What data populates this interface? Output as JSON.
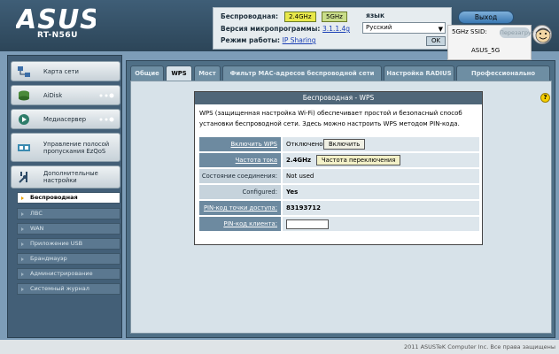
{
  "brand": {
    "logo": "ASUS",
    "model": "RT-N56U"
  },
  "sysinfo": {
    "wireless_label": "Беспроводная:",
    "freq_a": "2.4GHz",
    "freq_b": "5GHz",
    "firmware_label": "Версия микропрограммы:",
    "firmware_value": "3.1.1.4g",
    "mode_label": "Режим работы:",
    "mode_value": "IP Sharing"
  },
  "language": {
    "label": "язык",
    "selected": "Русский",
    "ok": "OK"
  },
  "logout": "Выход",
  "ssid": {
    "label": "5GHz SSID:",
    "value": "ASUS_5G",
    "ghost_button": "Перезагрузка"
  },
  "sidebar": {
    "items": [
      {
        "label": "Карта сети",
        "icon": "network-map-icon"
      },
      {
        "label": "AiDisk",
        "icon": "aidisk-icon"
      },
      {
        "label": "Медиасервер",
        "icon": "media-server-icon"
      },
      {
        "label": "Управление полосой пропускания EzQoS",
        "icon": "ezqos-icon"
      },
      {
        "label": "Дополнительные настройки",
        "icon": "advanced-settings-icon"
      }
    ],
    "sub_items": [
      "Беспроводная",
      "ЛВС",
      "WAN",
      "Приложение USB",
      "Брандмауэр",
      "Администрирование",
      "Системный журнал"
    ]
  },
  "tabs": [
    "Общие",
    "WPS",
    "Мост",
    "Фильтр MAC-адресов беспроводной сети",
    "Настройка RADIUS",
    "Профессионально"
  ],
  "wps": {
    "title": "Беспроводная - WPS",
    "description": "WPS (защищенная настройка Wi-Fi) обеспечивает простой и безопасный способ установки беспроводной сети. Здесь можно настроить WPS методом PIN-кода.",
    "rows": {
      "enable_label": "Включить WPS",
      "enable_value": "Отключено",
      "enable_button": "Включить",
      "freq_label": "Частота тока",
      "freq_value": "2.4GHz",
      "freq_button": "Частота переключения",
      "conn_label": "Состояние соединения:",
      "conn_value": "Not used",
      "configured_label": "Configured:",
      "configured_value": "Yes",
      "ap_pin_label": "PIN-код точки доступа:",
      "ap_pin_value": "83193712",
      "client_pin_label": "PIN-код клиента:",
      "client_pin_value": ""
    }
  },
  "footer": "2011 ASUSTeK Computer Inc. Все права защищены"
}
